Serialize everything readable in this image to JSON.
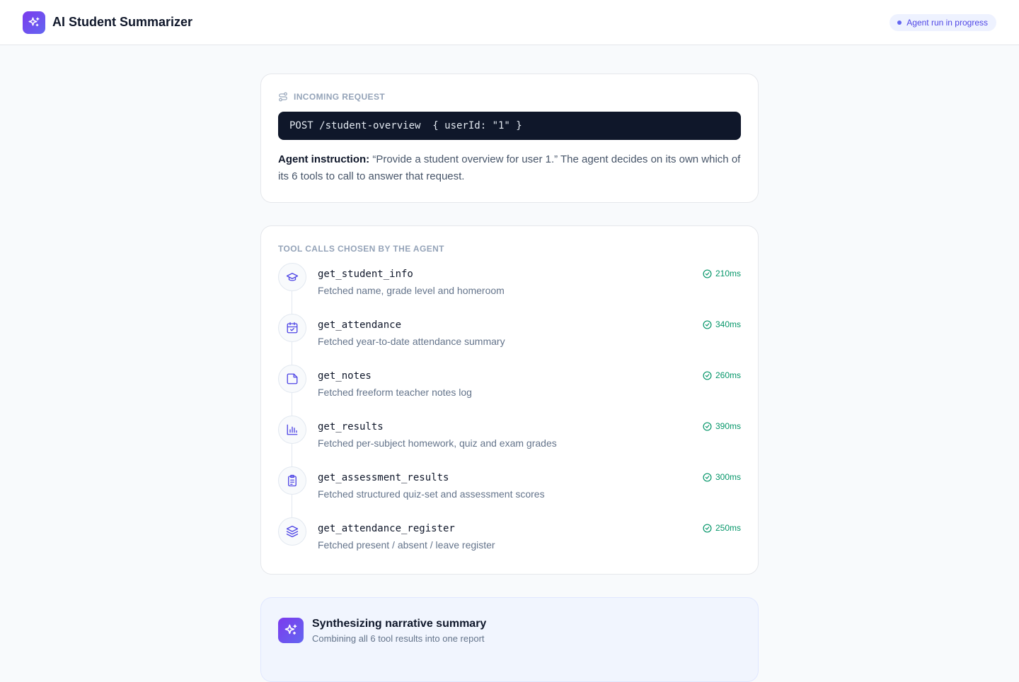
{
  "header": {
    "title": "AI Student Summarizer",
    "status": "Agent run in progress",
    "logo_icon": "sparkles-icon"
  },
  "request": {
    "label": "Incoming request",
    "label_icon": "route-icon",
    "code": "POST /student-overview  { userId: \"1\" }",
    "instruction_label": "Agent instruction:",
    "instruction_text": "“Provide a student overview for user 1.” The agent decides on its own which of its 6 tools to call to answer that request."
  },
  "tools": {
    "label": "Tool calls chosen by the agent",
    "items": [
      {
        "name": "get_student_info",
        "desc": "Fetched name, grade level and homeroom",
        "time": "210ms",
        "icon": "graduation-cap-icon"
      },
      {
        "name": "get_attendance",
        "desc": "Fetched year-to-date attendance summary",
        "time": "340ms",
        "icon": "calendar-check-icon"
      },
      {
        "name": "get_notes",
        "desc": "Fetched freeform teacher notes log",
        "time": "260ms",
        "icon": "sticky-note-icon"
      },
      {
        "name": "get_results",
        "desc": "Fetched per-subject homework, quiz and exam grades",
        "time": "390ms",
        "icon": "bar-chart-icon"
      },
      {
        "name": "get_assessment_results",
        "desc": "Fetched structured quiz-set and assessment scores",
        "time": "300ms",
        "icon": "clipboard-list-icon"
      },
      {
        "name": "get_attendance_register",
        "desc": "Fetched present / absent / leave register",
        "time": "250ms",
        "icon": "layers-icon"
      }
    ]
  },
  "synthesis": {
    "title": "Synthesizing narrative summary",
    "subtitle": "Combining all 6 tool results into one report"
  },
  "colors": {
    "accent": "#6366f1",
    "accent_deep": "#7c3aed",
    "success": "#059669",
    "code_bg": "#0f172a"
  }
}
